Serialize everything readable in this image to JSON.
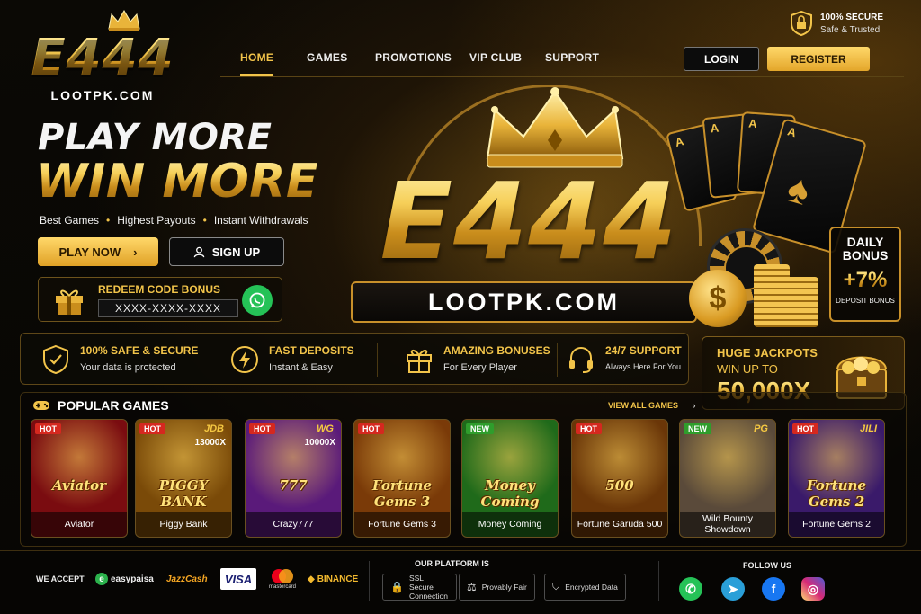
{
  "brand": {
    "logo_text": "E444",
    "domain": "LOOTPK.COM"
  },
  "header": {
    "secure_title": "100% SECURE",
    "secure_sub": "Safe & Trusted",
    "nav": [
      "HOME",
      "GAMES",
      "PROMOTIONS",
      "VIP CLUB",
      "SUPPORT"
    ],
    "active_nav": "HOME",
    "login": "LOGIN",
    "register": "REGISTER"
  },
  "hero": {
    "line1": "PLAY MORE",
    "line2": "WIN MORE",
    "taglines": [
      "Best Games",
      "Highest Payouts",
      "Instant Withdrawals"
    ],
    "play_now": "PLAY NOW",
    "sign_up": "SIGN UP",
    "redeem_label": "REDEEM CODE BONUS",
    "redeem_code": "XXXX-XXXX-XXXX",
    "center_brand": "E444",
    "center_site": "LOOTPK.COM",
    "card_rank": "A"
  },
  "daily_bonus": {
    "title1": "DAILY",
    "title2": "BONUS",
    "percent": "+7%",
    "sub": "DEPOSIT BONUS"
  },
  "features": [
    {
      "title": "100% SAFE & SECURE",
      "sub": "Your data is protected",
      "icon": "shield-check-icon"
    },
    {
      "title": "FAST DEPOSITS",
      "sub": "Instant & Easy",
      "icon": "lightning-icon"
    },
    {
      "title": "AMAZING BONUSES",
      "sub": "For Every Player",
      "icon": "gift-icon"
    },
    {
      "title": "24/7 SUPPORT",
      "sub": "Always Here For You",
      "icon": "headset-icon"
    }
  ],
  "jackpot": {
    "title": "HUGE JACKPOTS",
    "sub": "WIN UP TO",
    "amount": "50,000X"
  },
  "popular": {
    "title": "POPULAR GAMES",
    "view_all": "VIEW ALL GAMES",
    "games": [
      {
        "name": "Aviator",
        "badge": "HOT",
        "art_title": "Aviator",
        "provider": "",
        "prize": "",
        "bg": "#7a0c10"
      },
      {
        "name": "Piggy Bank",
        "badge": "HOT",
        "art_title": "PIGGY BANK",
        "provider": "JDB",
        "prize": "13000X",
        "bg": "#7a4a08"
      },
      {
        "name": "Crazy777",
        "badge": "HOT",
        "art_title": "777",
        "provider": "WG",
        "prize": "10000X",
        "bg": "#5a1a7a"
      },
      {
        "name": "Fortune Gems 3",
        "badge": "HOT",
        "art_title": "Fortune Gems 3",
        "provider": "",
        "prize": "",
        "bg": "#7a3a08"
      },
      {
        "name": "Money Coming",
        "badge": "NEW",
        "art_title": "Money Coming",
        "provider": "",
        "prize": "",
        "bg": "#1f6a1a"
      },
      {
        "name": "Fortune Garuda 500",
        "badge": "HOT",
        "art_title": "500",
        "provider": "",
        "prize": "",
        "bg": "#6a3608"
      },
      {
        "name": "Wild Bounty Showdown",
        "badge": "NEW",
        "art_title": "",
        "provider": "PG",
        "prize": "",
        "bg": "#5a4a3a"
      },
      {
        "name": "Fortune Gems 2",
        "badge": "HOT",
        "art_title": "Fortune Gems 2",
        "provider": "JILI",
        "prize": "",
        "bg": "#3a1a6a"
      }
    ]
  },
  "footer": {
    "we_accept": "WE ACCEPT",
    "payments": [
      "easypaisa",
      "JazzCash",
      "VISA",
      "mastercard",
      "BINANCE"
    ],
    "platform_title": "OUR PLATFORM IS",
    "trust": [
      "SSL Secure Connection",
      "Provably Fair",
      "Encrypted Data"
    ],
    "follow_title": "FOLLOW US",
    "social": [
      {
        "name": "whatsapp",
        "color": "#25c257"
      },
      {
        "name": "telegram",
        "color": "#2a9fd8"
      },
      {
        "name": "facebook",
        "color": "#1877f2"
      },
      {
        "name": "instagram",
        "color": "#d62976"
      }
    ]
  },
  "colors": {
    "gold": "#f2c44a",
    "dark": "#0b0905",
    "hot": "#d5281f",
    "new": "#2f9d2c"
  }
}
